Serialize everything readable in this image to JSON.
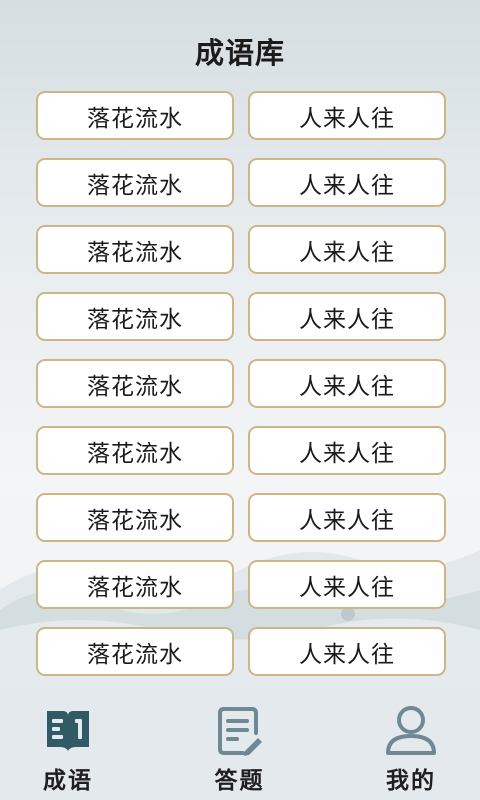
{
  "page": {
    "title": "成语库"
  },
  "idioms": [
    [
      "落花流水",
      "人来人往"
    ],
    [
      "落花流水",
      "人来人往"
    ],
    [
      "落花流水",
      "人来人往"
    ],
    [
      "落花流水",
      "人来人往"
    ],
    [
      "落花流水",
      "人来人往"
    ],
    [
      "落花流水",
      "人来人往"
    ],
    [
      "落花流水",
      "人来人往"
    ],
    [
      "落花流水",
      "人来人往"
    ],
    [
      "落花流水",
      "人来人往"
    ]
  ],
  "bottom_nav": {
    "active_index": 0,
    "items": [
      {
        "label": "成语",
        "icon": "book-icon"
      },
      {
        "label": "答题",
        "icon": "quiz-icon"
      },
      {
        "label": "我的",
        "icon": "person-icon"
      }
    ]
  },
  "colors": {
    "button_border": "#cdb586",
    "button_bg": "#ffffff",
    "nav_active": "#2f5a66",
    "nav_inactive": "#6f8893",
    "nav_bg": "#e3e9ed"
  }
}
